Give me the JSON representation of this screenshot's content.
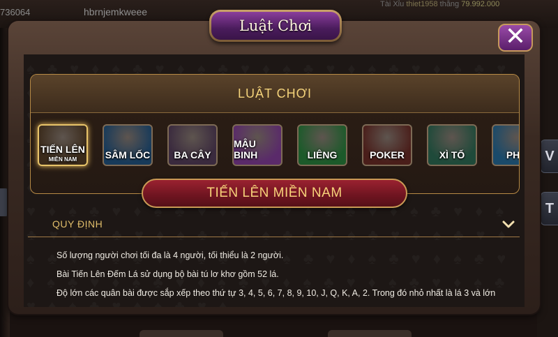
{
  "background": {
    "user_id": "736064",
    "username": "hbrnjemkweee",
    "ticker": {
      "game": "Tài Xỉu",
      "user": "thiet1958",
      "label": "thắng",
      "amount": "79.992.000"
    },
    "right_buttons": [
      "V",
      "T"
    ]
  },
  "modal": {
    "title": "Luật Chơi",
    "close_glyph": "✕"
  },
  "games_panel": {
    "title": "LUẬT CHƠI",
    "games": [
      {
        "name": "TIẾN LÊN",
        "sub": "MIỀN NAM",
        "selected": true,
        "color": "#3a2a1a"
      },
      {
        "name": "SÂM LỐC",
        "sub": "",
        "selected": false,
        "color": "#173a5a"
      },
      {
        "name": "BA CÂY",
        "sub": "",
        "selected": false,
        "color": "#3a2a3e"
      },
      {
        "name": "MẬU BINH",
        "sub": "",
        "selected": false,
        "color": "#5a2a6a"
      },
      {
        "name": "LIÊNG",
        "sub": "",
        "selected": false,
        "color": "#1c5a2a"
      },
      {
        "name": "POKER",
        "sub": "",
        "selected": false,
        "color": "#4a1e1a"
      },
      {
        "name": "XÌ TỐ",
        "sub": "",
        "selected": false,
        "color": "#1f4a3a"
      },
      {
        "name": "PHỎ",
        "sub": "",
        "selected": false,
        "color": "#1a4a6a"
      }
    ]
  },
  "selected_game": {
    "title": "TIẾN LÊN MIỀN NAM"
  },
  "rules": {
    "section_label": "QUY ĐỊNH",
    "lines": [
      "Số lượng người chơi tối đa là 4 người, tối thiểu là 2 người.",
      "Bài Tiến Lên Đếm Lá sử dụng bộ bài tú lơ khơ gồm 52 lá.",
      "Độ lớn các quân bài được sắp xếp theo thứ tự 3, 4, 5, 6, 7, 8, 9, 10, J, Q, K, A, 2. Trong đó nhỏ nhất là lá 3 và lớn"
    ]
  },
  "colors": {
    "gold": "#e0bd6a",
    "purple": "#5a1e6a",
    "red": "#7a1424"
  }
}
